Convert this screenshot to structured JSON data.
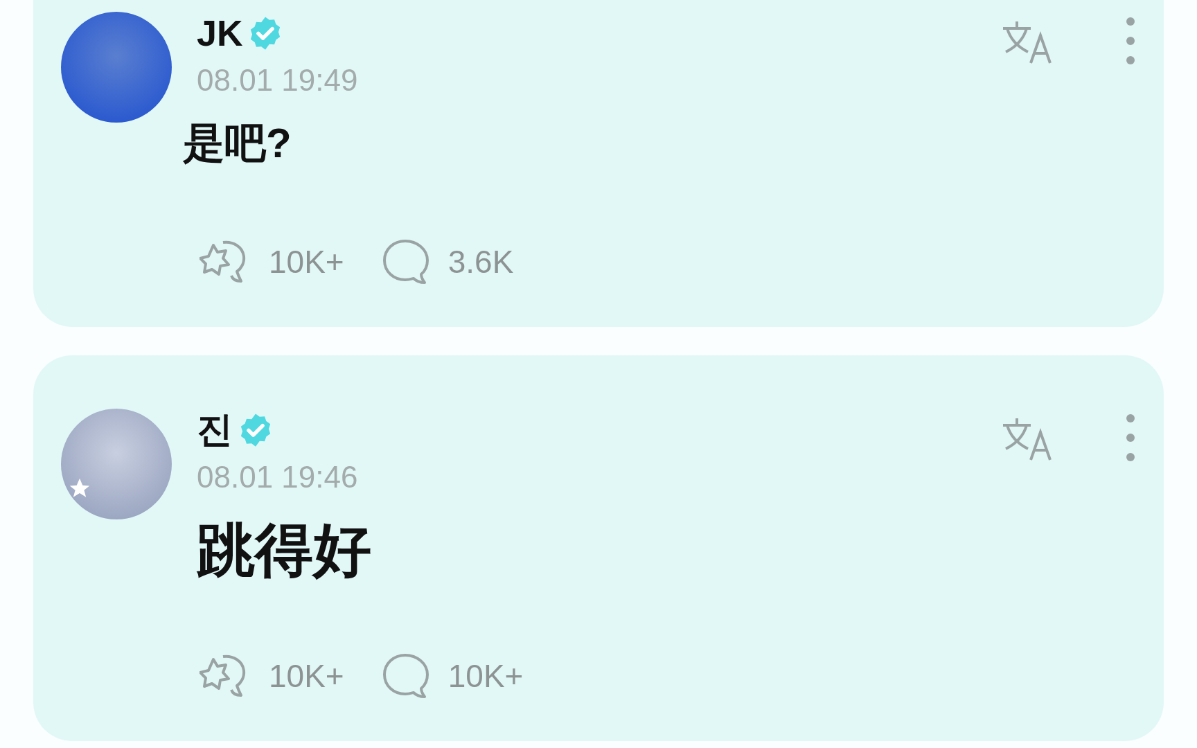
{
  "posts": [
    {
      "author": "JK",
      "verified": true,
      "time": "08.01 19:49",
      "text": "是吧?",
      "reactions": "10K+",
      "comments": "3.6K"
    },
    {
      "author": "진",
      "verified": true,
      "time": "08.01 19:46",
      "text": "跳得好",
      "reactions": "10K+",
      "comments": "10K+"
    }
  ]
}
